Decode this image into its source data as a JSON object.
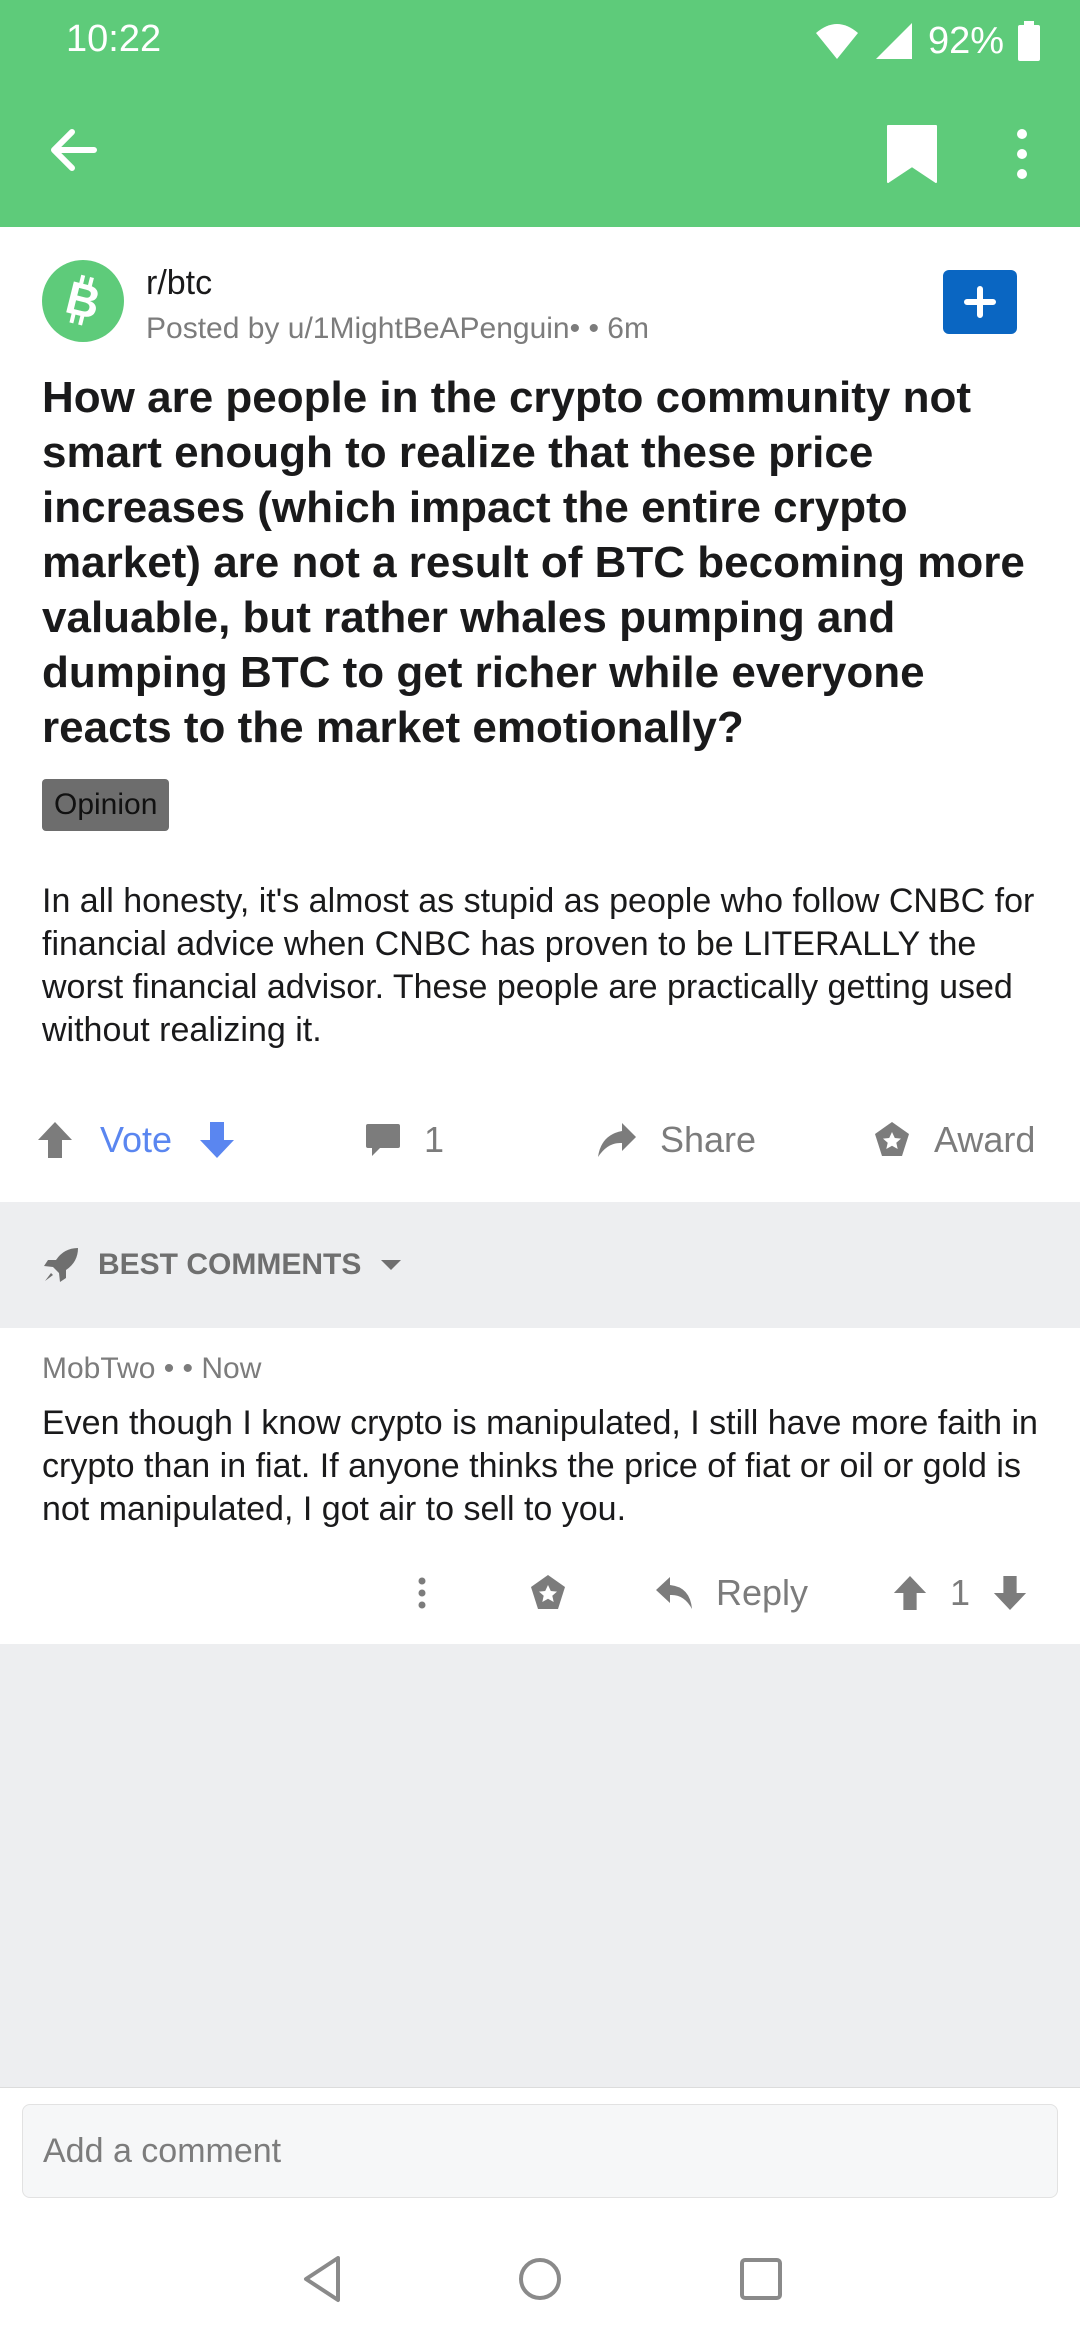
{
  "status_bar": {
    "time": "10:22",
    "battery": "92%"
  },
  "colors": {
    "appbar": "#5ecb7a",
    "vote_accent": "#5a86f0",
    "join_button": "#0a66c2"
  },
  "icons": [
    "back-arrow-icon",
    "bookmark-icon",
    "more-vertical-icon",
    "bitcoin-icon",
    "plus-icon",
    "upvote-icon",
    "downvote-icon",
    "comment-icon",
    "share-icon",
    "award-icon",
    "rocket-icon",
    "chevron-down-icon",
    "wifi-icon",
    "signal-icon",
    "battery-icon"
  ],
  "post": {
    "subreddit": "r/btc",
    "posted_by": "Posted by u/1MightBeAPenguin•  • 6m",
    "title": "How are people in the crypto community not smart enough to realize that these price increases (which impact the entire crypto market) are not a result of BTC becoming more valuable, but rather whales pumping and dumping BTC to get richer while everyone reacts to the market emotionally?",
    "flair": "Opinion",
    "body": "In all honesty, it's almost as stupid as people who follow CNBC for financial advice when CNBC has proven to be LITERALLY the worst financial advisor. These people are practically getting used without realizing it.",
    "actions": {
      "vote_label": "Vote",
      "comment_count": "1",
      "share_label": "Share",
      "award_label": "Award"
    }
  },
  "comments_section": {
    "sort_label": "BEST COMMENTS"
  },
  "comment": {
    "author": "MobTwo •  • Now",
    "body": "Even though I know crypto is manipulated, I still have more faith in crypto than in fiat. If anyone thinks the price of fiat or oil or gold is not manipulated, I got air to sell to you.",
    "reply_label": "Reply",
    "score": "1"
  },
  "composer": {
    "placeholder": "Add a comment"
  }
}
